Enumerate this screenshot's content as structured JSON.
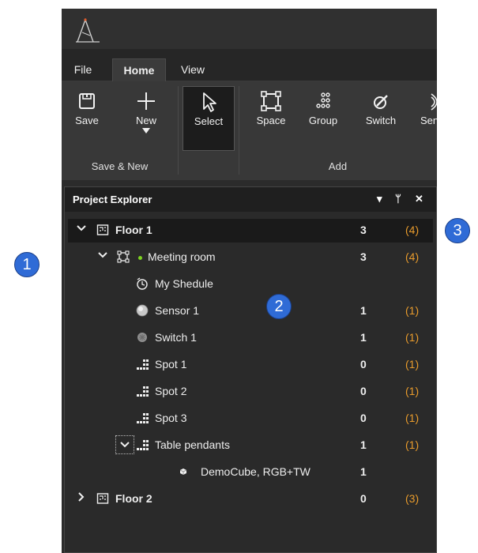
{
  "menu": {
    "tabs": [
      "File",
      "Home",
      "View"
    ],
    "active": "Home"
  },
  "ribbon": {
    "buttons": {
      "save": "Save",
      "new": "New",
      "select": "Select",
      "space": "Space",
      "group": "Group",
      "switch": "Switch",
      "sensor": "Sen"
    },
    "groups": {
      "save_new": "Save & New",
      "add": "Add"
    }
  },
  "panel": {
    "title": "Project Explorer",
    "controls": {
      "dropdown": "▾",
      "pin": "ᛘ",
      "close": "✕"
    }
  },
  "tree": [
    {
      "name": "Floor 1",
      "count": "3",
      "total": "(4)",
      "icon": "floor-icon",
      "expanded": true
    },
    {
      "name": "Meeting room",
      "count": "3",
      "total": "(4)",
      "icon": "space-icon",
      "expanded": true
    },
    {
      "name": "My Shedule",
      "count": "",
      "total": "",
      "icon": "schedule-icon"
    },
    {
      "name": "Sensor 1",
      "count": "1",
      "total": "(1)",
      "icon": "sensor-icon"
    },
    {
      "name": "Switch 1",
      "count": "1",
      "total": "(1)",
      "icon": "switch-icon"
    },
    {
      "name": "Spot 1",
      "count": "0",
      "total": "(1)",
      "icon": "group-icon"
    },
    {
      "name": "Spot 2",
      "count": "0",
      "total": "(1)",
      "icon": "group-icon"
    },
    {
      "name": "Spot 3",
      "count": "0",
      "total": "(1)",
      "icon": "group-icon"
    },
    {
      "name": "Table pendants",
      "count": "1",
      "total": "(1)",
      "icon": "group-icon",
      "expanded": true
    },
    {
      "name": "DemoCube, RGB+TW",
      "count": "1",
      "total": "",
      "icon": "device-icon"
    },
    {
      "name": "Floor 2",
      "count": "0",
      "total": "(3)",
      "icon": "floor-icon",
      "expanded": false
    }
  ],
  "callouts": [
    "1",
    "2",
    "3"
  ]
}
